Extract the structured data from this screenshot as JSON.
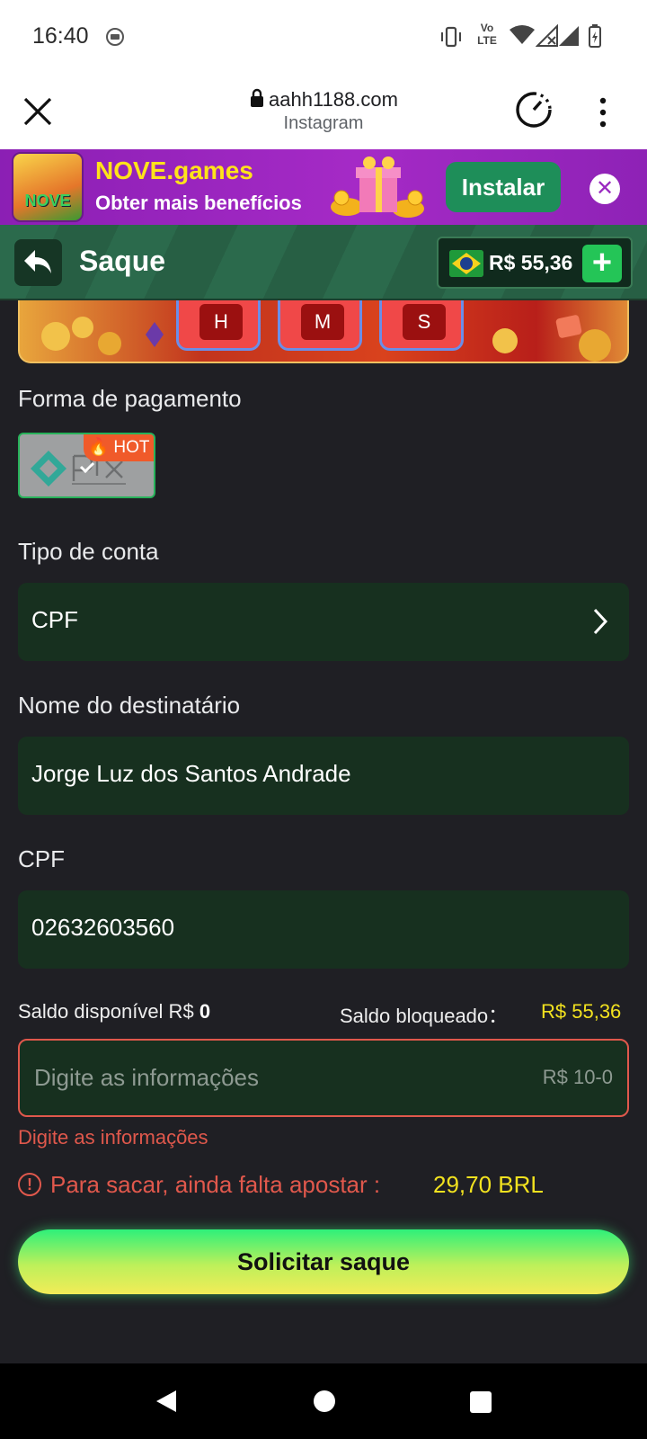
{
  "status_bar": {
    "time": "16:40",
    "net_label": "Vo LTE"
  },
  "browser": {
    "url": "aahh1188.com",
    "source": "Instagram"
  },
  "banner": {
    "logo_text": "NOVE",
    "title": "NOVE.games",
    "subtitle": "Obter mais benefícios",
    "install_label": "Instalar"
  },
  "header": {
    "title": "Saque",
    "balance": "R$ 55,36"
  },
  "promo": {
    "slots": [
      "H",
      "M",
      "S"
    ]
  },
  "payment": {
    "label": "Forma de pagamento",
    "method": "pix",
    "badge": "HOT"
  },
  "account_type": {
    "label": "Tipo de conta",
    "value": "CPF"
  },
  "recipient": {
    "label": "Nome do destinatário",
    "value": "Jorge Luz dos Santos Andrade"
  },
  "cpf": {
    "label": "CPF",
    "value": "02632603560"
  },
  "saldo": {
    "available_label": "Saldo disponível R$",
    "available_value": "0",
    "blocked_label": "Saldo bloqueado：",
    "blocked_value": "R$ 55,36"
  },
  "amount": {
    "placeholder": "Digite as informações",
    "range": "R$ 10-0",
    "error": "Digite as informações"
  },
  "warning": {
    "text": "Para sacar, ainda falta apostar :",
    "amount": "29,70 BRL"
  },
  "submit_label": "Solicitar saque",
  "colors": {
    "accent_green": "#24c557",
    "error_red": "#e0584c",
    "highlight_yellow": "#f2e21f"
  }
}
